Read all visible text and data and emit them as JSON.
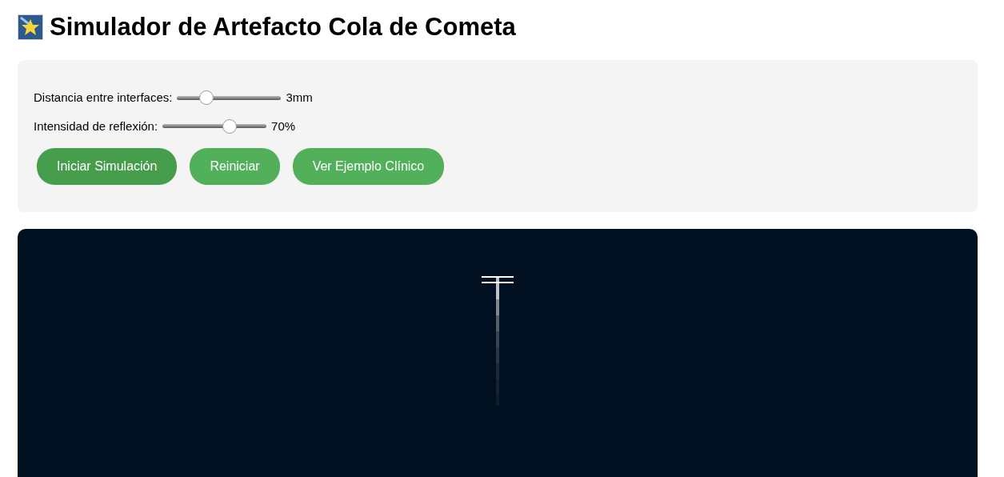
{
  "title": "Simulador de Artefacto Cola de Cometa",
  "controls": [
    {
      "label": "Distancia entre interfaces:",
      "level": 0.25,
      "reading": "3mm"
    },
    {
      "label": "Intensidad de reflexión:",
      "level": 0.67,
      "reading": "70%"
    }
  ],
  "buttons": [
    {
      "label": "Iniciar Simulación",
      "selected": true
    },
    {
      "label": "Reiniciar",
      "selected": false
    },
    {
      "label": "Ver Ejemplo Clínico",
      "selected": false
    }
  ]
}
